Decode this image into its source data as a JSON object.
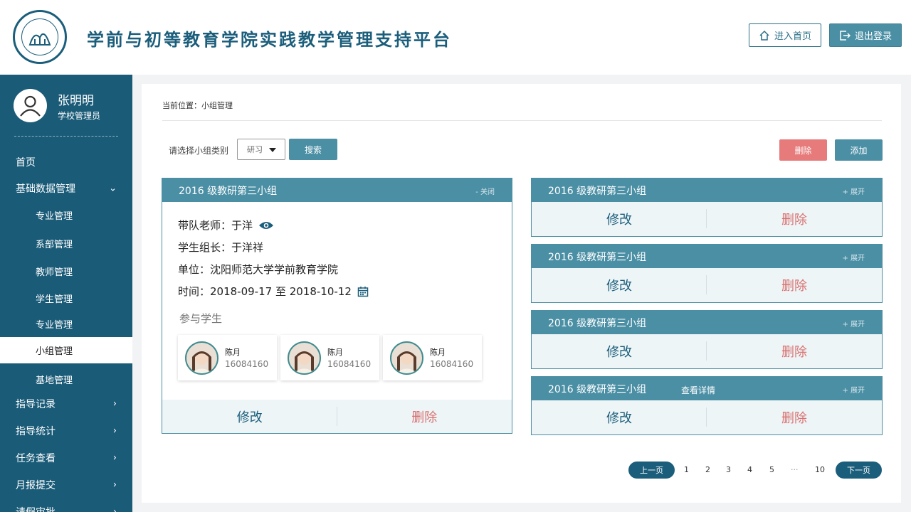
{
  "header": {
    "title": "学前与初等教育学院实践教学管理支持平台",
    "home_button": "进入首页",
    "logout_button": "退出登录"
  },
  "user": {
    "name": "张明明",
    "role": "学校管理员"
  },
  "sidebar": {
    "items": [
      {
        "label": "首页",
        "level": 1
      },
      {
        "label": "基础数据管理",
        "level": 1,
        "chevron": "down"
      },
      {
        "label": "专业管理",
        "level": 2
      },
      {
        "label": "系部管理",
        "level": 2
      },
      {
        "label": "教师管理",
        "level": 2
      },
      {
        "label": "学生管理",
        "level": 2
      },
      {
        "label": "专业管理",
        "level": 2
      },
      {
        "label": "小组管理",
        "level": 2,
        "active": true
      },
      {
        "label": "基地管理",
        "level": 2
      },
      {
        "label": "指导记录",
        "level": 1,
        "chevron": "right"
      },
      {
        "label": "指导统计",
        "level": 1,
        "chevron": "right"
      },
      {
        "label": "任务查看",
        "level": 1,
        "chevron": "right"
      },
      {
        "label": "月报提交",
        "level": 1,
        "chevron": "right"
      },
      {
        "label": "请假审批",
        "level": 1,
        "chevron": "right"
      }
    ]
  },
  "main": {
    "breadcrumb": "当前位置：小组管理",
    "filter_label": "请选择小组类别",
    "select_value": "研习",
    "search_button": "搜索",
    "delete_button": "删除",
    "add_button": "添加"
  },
  "group_card": {
    "title": "2016 级教研第三小组",
    "toggle": "- 关闭",
    "teacher": "带队老师：于洋",
    "leader": "学生组长：于洋祥",
    "unit": "单位：沈阳师范大学学前教育学院",
    "time": "时间：2018-09-17 至 2018-10-12",
    "students_title": "参与学生",
    "students": [
      {
        "name": "陈月",
        "id": "16084160"
      },
      {
        "name": "陈月",
        "id": "16084160"
      },
      {
        "name": "陈月",
        "id": "16084160"
      }
    ],
    "edit": "修改",
    "delete": "删除"
  },
  "collapsed_cards": [
    {
      "title": "2016 级教研第三小组",
      "toggle": "+ 展开",
      "edit": "修改",
      "delete": "删除"
    },
    {
      "title": "2016 级教研第三小组",
      "toggle": "+ 展开",
      "edit": "修改",
      "delete": "删除"
    },
    {
      "title": "2016 级教研第三小组",
      "toggle": "+ 展开",
      "edit": "修改",
      "delete": "删除"
    },
    {
      "title": "2016 级教研第三小组",
      "toggle": "+ 展开",
      "edit": "修改",
      "delete": "删除",
      "hover_text": "查看详情"
    }
  ],
  "pagination": {
    "prev": "上一页",
    "pages": [
      "1",
      "2",
      "3",
      "4",
      "5",
      "···",
      "10"
    ],
    "next": "下一页"
  },
  "colors": {
    "primary": "#1a5b78",
    "accent": "#4b8fa5",
    "danger": "#e77a7a"
  }
}
